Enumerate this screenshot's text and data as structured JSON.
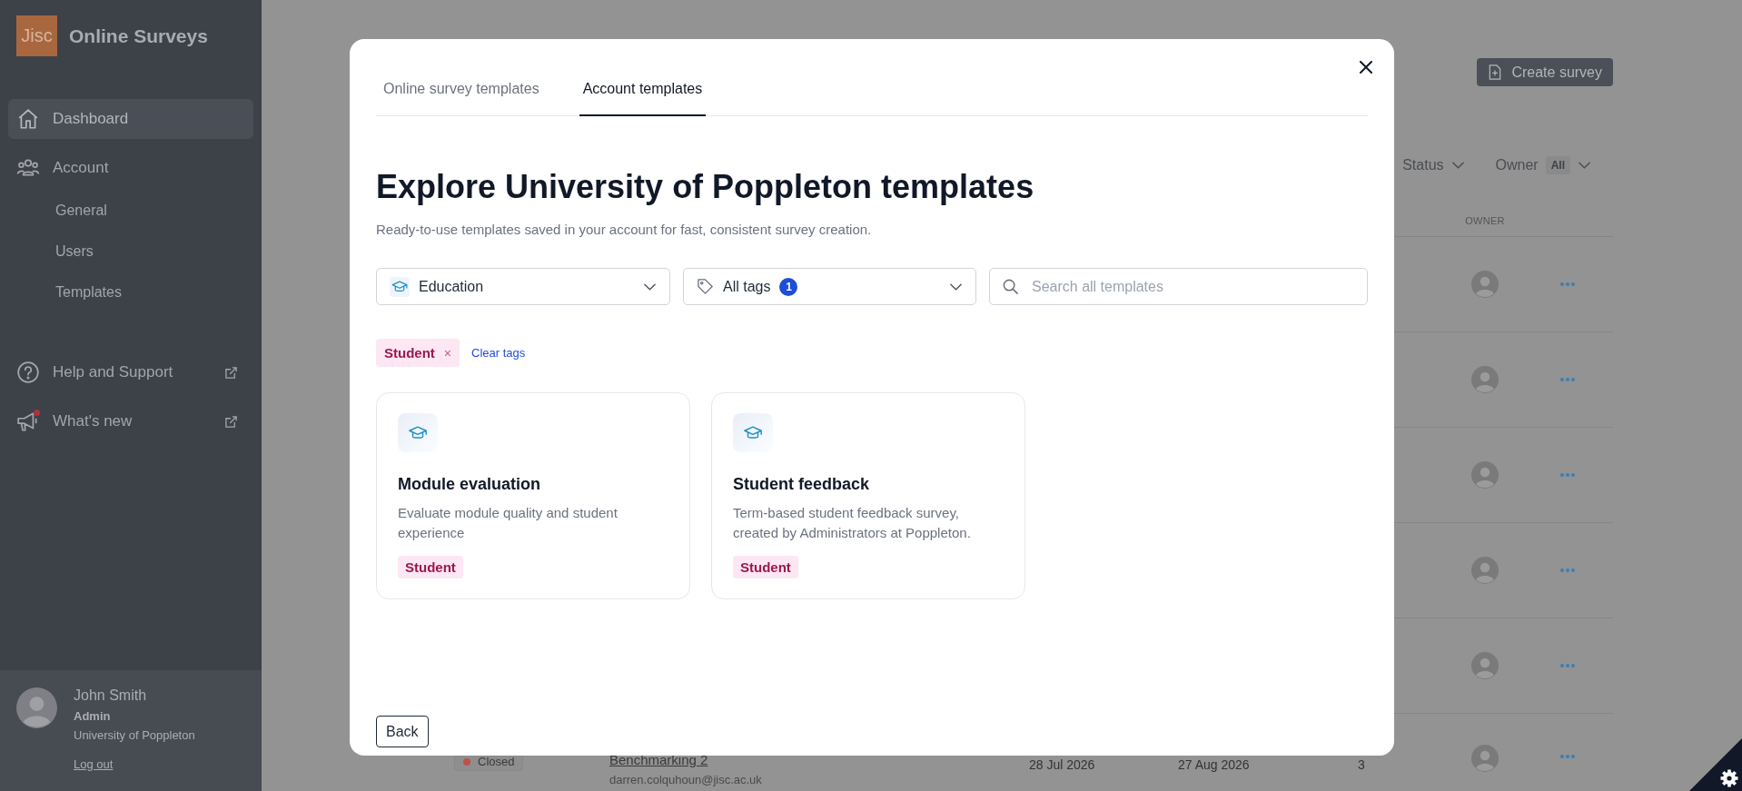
{
  "sidebar": {
    "logo": "Jisc",
    "app_name": "Online Surveys",
    "nav": [
      {
        "kind": "home",
        "label": "Dashboard",
        "selected": true
      },
      {
        "kind": "people",
        "label": "Account",
        "selected": false,
        "children": [
          {
            "label": "General",
            "selected": false
          },
          {
            "label": "Users",
            "selected": false
          },
          {
            "label": "Templates",
            "selected": false
          }
        ]
      },
      {
        "kind": "help",
        "label": "Help and Support",
        "selected": false,
        "external": true,
        "notification": false
      },
      {
        "kind": "megaphone",
        "label": "What's new",
        "selected": false,
        "external": true,
        "notification": true
      }
    ],
    "user": {
      "name": "John Smith",
      "role": "Admin",
      "organization": "University of Poppleton",
      "logout": "Log out"
    }
  },
  "page": {
    "create_button": "Create survey",
    "filters": [
      {
        "label": "Status"
      },
      {
        "label": "Owner",
        "value": "All"
      }
    ],
    "owner_column": "OWNER",
    "rows": [
      {
        "kind": "covered"
      },
      {
        "kind": "covered"
      },
      {
        "kind": "covered"
      },
      {
        "kind": "covered"
      },
      {
        "kind": "covered"
      },
      {
        "kind": "full",
        "status": "Closed",
        "color": "#c0504d",
        "name": "Benchmarking 2",
        "owner_email": "darren.colquhoun@jisc.ac.uk",
        "start": "28 Jul 2026",
        "end": "27 Aug 2026",
        "responses": "3"
      }
    ]
  },
  "modal": {
    "tabs": [
      {
        "label": "Online survey templates",
        "selected": false
      },
      {
        "label": "Account templates",
        "selected": true
      }
    ],
    "title": "Explore University of Poppleton templates",
    "subtitle": "Ready-to-use templates saved in your account for fast, consistent survey creation.",
    "category_filter": {
      "value": "Education"
    },
    "tag_filter": {
      "label": "All tags",
      "count": "1"
    },
    "search": {
      "placeholder": "Search all templates"
    },
    "active_tags": [
      {
        "label": "Student",
        "remove": "×"
      }
    ],
    "clear_tags": "Clear tags",
    "templates": [
      {
        "title": "Module evaluation",
        "description": "Evaluate module quality and student experience",
        "tags": [
          {
            "label": "Student"
          }
        ]
      },
      {
        "title": "Student feedback",
        "description": "Term-based student feedback survey, created by Administrators at Poppleton.",
        "tags": [
          {
            "label": "Student"
          }
        ]
      }
    ],
    "back_button": "Back"
  }
}
